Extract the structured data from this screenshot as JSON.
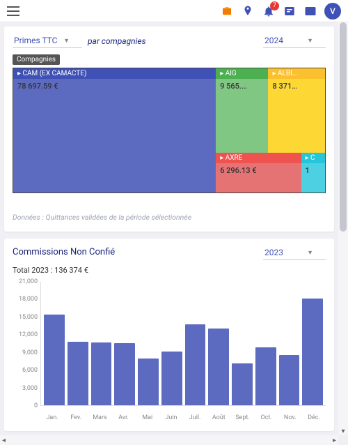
{
  "topbar": {
    "notification_count": "7",
    "avatar_initial": "V"
  },
  "card1": {
    "metric_select": "Primes TTC",
    "mid_label": "par compagnies",
    "year_select": "2024",
    "pill": "Compagnies",
    "footnote": "Données : Quittances validées de la période sélectionnée"
  },
  "treemap": {
    "main": {
      "label": "▸ CAM (EX CAMACTE)",
      "value": "78 697.59 €"
    },
    "r1a": {
      "label": "▸ AIG",
      "value": "9 565.…"
    },
    "r1b": {
      "label": "▸ ALBI…",
      "value": "8 371…"
    },
    "r2a": {
      "label": "▸ AXRE",
      "value": "6 296.13 €"
    },
    "r2b": {
      "label": "▸ C",
      "value": "1"
    }
  },
  "card2": {
    "title": "Commissions Non Confié",
    "year_select": "2023",
    "subtitle": "Total 2023 : 136 374 €"
  },
  "chart_data": {
    "type": "bar",
    "title": "Commissions Non Confié",
    "ylabel": "",
    "xlabel": "",
    "ylim": [
      0,
      21000
    ],
    "yticks": [
      0,
      3000,
      6000,
      9000,
      12000,
      15000,
      18000,
      21000
    ],
    "categories": [
      "Jan.",
      "Fev.",
      "Mars",
      "Avr.",
      "Mai",
      "Juin",
      "Juil.",
      "Août",
      "Sept.",
      "Oct.",
      "Nov.",
      "Déc."
    ],
    "values": [
      15400,
      10800,
      10700,
      10600,
      8000,
      9100,
      13800,
      13000,
      7100,
      9900,
      8600,
      18200
    ]
  }
}
